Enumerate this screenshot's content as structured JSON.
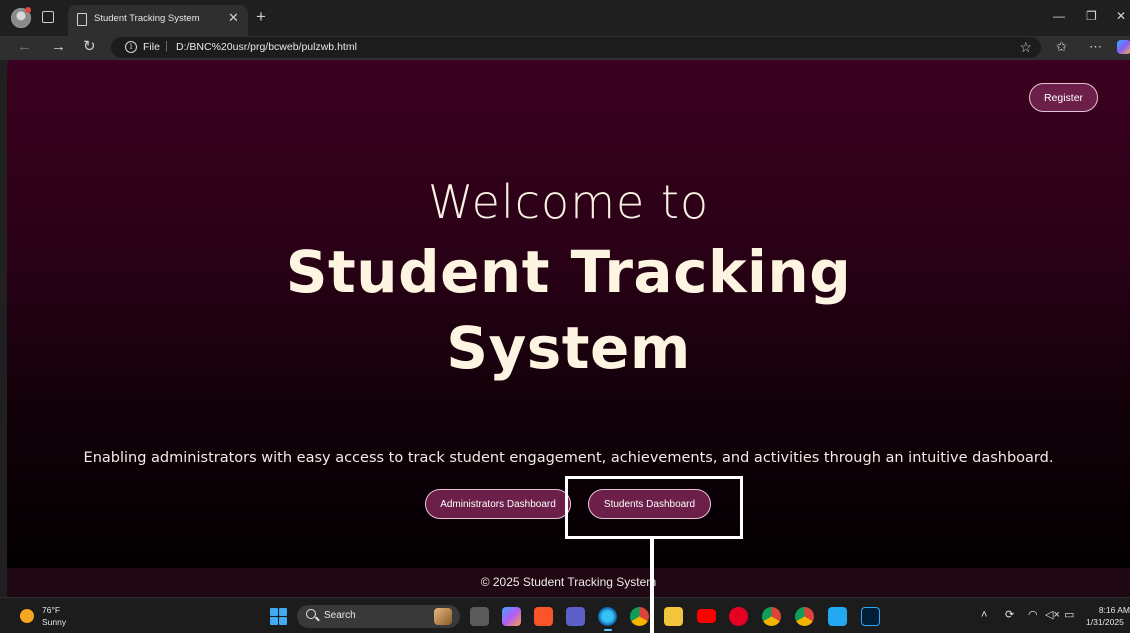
{
  "browser": {
    "tab_title": "Student Tracking System",
    "tab_close": "✕",
    "new_tab": "+",
    "address_scheme": "File",
    "address_url": "D:/BNC%20usr/prg/bcweb/pulzwb.html",
    "window_controls": {
      "minimize": "—",
      "restore": "❐",
      "close": "✕"
    }
  },
  "page": {
    "register_label": "Register",
    "welcome_text": "Welcome to",
    "title_line1": "Student Tracking",
    "title_line2": "System",
    "tagline": "Enabling administrators with easy access to track student engagement, achievements, and activities through an intuitive dashboard.",
    "admin_button_label": "Administrators Dashboard",
    "student_button_label": "Students Dashboard",
    "footer_text": "© 2025 Student Tracking System"
  },
  "taskbar": {
    "weather_temp": "76°F",
    "weather_condition": "Sunny",
    "search_label": "Search",
    "apps": [
      "file-explorer-icon",
      "copilot-icon",
      "brave-icon",
      "teams-icon",
      "edge-icon",
      "chrome-icon",
      "folder-icon",
      "youtube-icon",
      "pinterest-icon",
      "chrome-profile-icon",
      "chrome-alt-icon",
      "vscode-icon",
      "photoshop-icon"
    ],
    "clock_time": "8:16 AM",
    "clock_date": "1/31/2025"
  },
  "colors": {
    "hero_top": "#3c0120",
    "hero_bottom": "#000000",
    "button_fill": "#6b1f49",
    "button_border": "#e6c3d4",
    "hero_text": "#fdf4e2"
  }
}
